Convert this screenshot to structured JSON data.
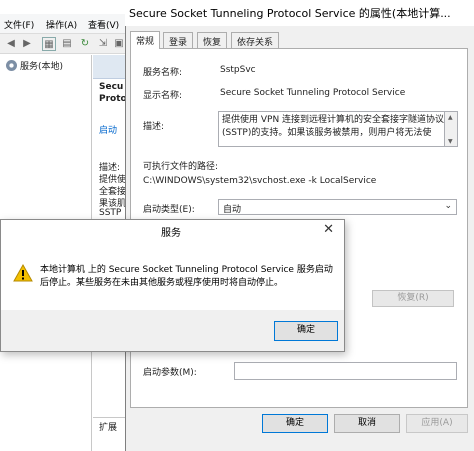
{
  "console": {
    "menu": [
      "文件(F)",
      "操作(A)",
      "查看(V)"
    ],
    "tree_item": "服务(本地)",
    "detail_lines": [
      "Secu",
      "Protoc",
      "启动",
      "描述:",
      "提供使",
      "全套接",
      "果该肌",
      "SSTP"
    ],
    "extended_tab": "扩展"
  },
  "props": {
    "title": "Secure Socket Tunneling Protocol Service 的属性(本地计算...",
    "tabs": [
      "常规",
      "登录",
      "恢复",
      "依存关系"
    ],
    "service_name_label": "服务名称:",
    "service_name": "SstpSvc",
    "display_name_label": "显示名称:",
    "display_name": "Secure Socket Tunneling Protocol Service",
    "description_label": "描述:",
    "description": "提供使用 VPN 连接到远程计算机的安全套接字隧道协议(SSTP)的支持。如果该服务被禁用，则用户将无法使",
    "exec_path_label": "可执行文件的路径:",
    "exec_path": "C:\\WINDOWS\\system32\\svchost.exe -k LocalService",
    "startup_type_label": "启动类型(E):",
    "startup_type": "自动",
    "resume_button": "恢复(R)",
    "start_params_label": "启动参数(M):",
    "start_params_value": "",
    "ok_button": "确定",
    "cancel_button": "取消",
    "apply_button": "应用(A)"
  },
  "message_box": {
    "title": "服务",
    "text": "本地计算机 上的 Secure Socket Tunneling Protocol Service 服务启动后停止。某些服务在未由其他服务或程序使用时将自动停止。",
    "ok_button": "确定",
    "close_glyph": "✕"
  },
  "colors": {
    "accent": "#0078d7",
    "link": "#0066cc",
    "warning": "#f3c000"
  }
}
